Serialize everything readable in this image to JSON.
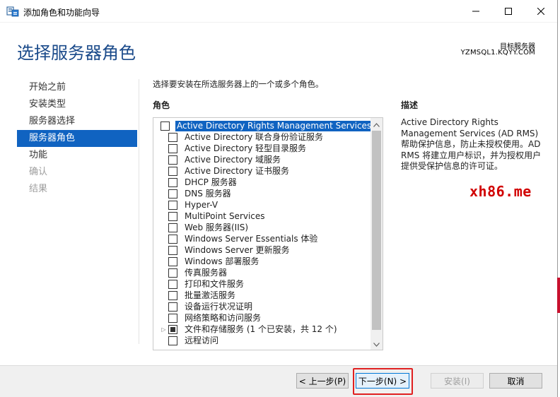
{
  "window": {
    "title": "添加角色和功能向导"
  },
  "header": {
    "page_title": "选择服务器角色",
    "target_label": "目标服务器",
    "target_server": "YZMSQL1.KQYY.COM"
  },
  "nav": {
    "items": [
      {
        "label": "开始之前",
        "state": "normal"
      },
      {
        "label": "安装类型",
        "state": "normal"
      },
      {
        "label": "服务器选择",
        "state": "normal"
      },
      {
        "label": "服务器角色",
        "state": "active"
      },
      {
        "label": "功能",
        "state": "normal"
      },
      {
        "label": "确认",
        "state": "disabled"
      },
      {
        "label": "结果",
        "state": "disabled"
      }
    ]
  },
  "content": {
    "instruction": "选择要安装在所选服务器上的一个或多个角色。",
    "roles_header": "角色",
    "description_header": "描述",
    "roles": [
      {
        "label": "Active Directory Rights Management Services"
      },
      {
        "label": "Active Directory 联合身份验证服务"
      },
      {
        "label": "Active Directory 轻型目录服务"
      },
      {
        "label": "Active Directory 域服务"
      },
      {
        "label": "Active Directory 证书服务"
      },
      {
        "label": "DHCP 服务器"
      },
      {
        "label": "DNS 服务器"
      },
      {
        "label": "Hyper-V"
      },
      {
        "label": "MultiPoint Services"
      },
      {
        "label": "Web 服务器(IIS)"
      },
      {
        "label": "Windows Server Essentials 体验"
      },
      {
        "label": "Windows Server 更新服务"
      },
      {
        "label": "Windows 部署服务"
      },
      {
        "label": "传真服务器"
      },
      {
        "label": "打印和文件服务"
      },
      {
        "label": "批量激活服务"
      },
      {
        "label": "设备运行状况证明"
      },
      {
        "label": "网络策略和访问服务"
      },
      {
        "label": "文件和存储服务 (1 个已安装，共 12 个)"
      },
      {
        "label": "远程访问"
      }
    ],
    "description": "Active Directory Rights Management Services (AD RMS) 帮助保护信息，防止未授权使用。AD RMS 将建立用户标识，并为授权用户提供受保护信息的许可证。",
    "watermark": "xh86.me"
  },
  "buttons": {
    "previous": "< 上一步(P)",
    "next": "下一步(N) >",
    "install": "安装(I)",
    "cancel": "取消"
  },
  "colors": {
    "accent": "#1063c1",
    "title": "#1a4a8a",
    "highlight_box": "#e02020",
    "watermark": "#d10000"
  }
}
